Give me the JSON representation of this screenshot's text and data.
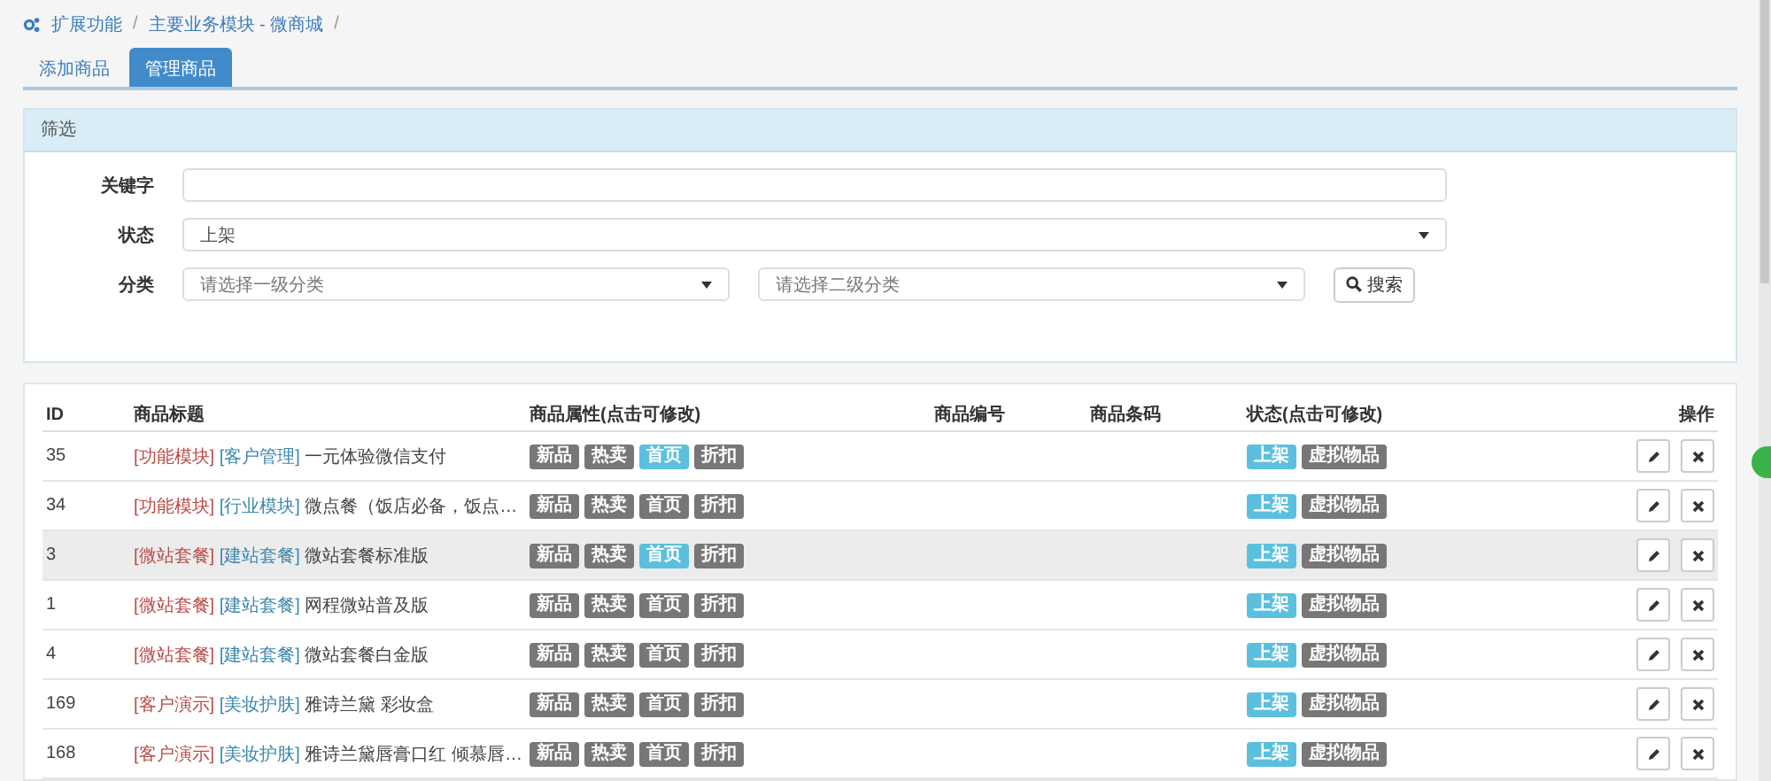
{
  "breadcrumb": [
    {
      "label": "扩展功能",
      "separator": "/"
    },
    {
      "label": "主要业务模块 - 微商城",
      "separator": "/"
    }
  ],
  "tabs": [
    {
      "label": "添加商品",
      "selected": false
    },
    {
      "label": "管理商品",
      "selected": true
    }
  ],
  "filter": {
    "title": "筛选",
    "keyword": {
      "label": "关键字"
    },
    "status": {
      "label": "状态",
      "value": "上架"
    },
    "category": {
      "label": "分类",
      "first_placeholder": "请选择一级分类",
      "second_placeholder": "请选择二级分类"
    },
    "search_button": "搜索"
  },
  "table": {
    "columns": [
      "ID",
      "商品标题",
      "商品属性(点击可修改)",
      "商品编号",
      "商品条码",
      "状态(点击可修改)",
      "操作"
    ],
    "rows": [
      {
        "id": "35",
        "group": "[功能模块]",
        "category": "[客户管理]",
        "title": "一元体验微信支付",
        "highlighted": false,
        "attributes": [
          {
            "label": "新品",
            "on": false
          },
          {
            "label": "热卖",
            "on": false
          },
          {
            "label": "首页",
            "on": true
          },
          {
            "label": "折扣",
            "on": false
          }
        ],
        "status": [
          {
            "label": "上架",
            "on": true
          },
          {
            "label": "虚拟物品",
            "on": false
          }
        ]
      },
      {
        "id": "34",
        "group": "[功能模块]",
        "category": "[行业模块]",
        "title": "微点餐（饭店必备，饭点…",
        "highlighted": false,
        "attributes": [
          {
            "label": "新品",
            "on": false
          },
          {
            "label": "热卖",
            "on": false
          },
          {
            "label": "首页",
            "on": false
          },
          {
            "label": "折扣",
            "on": false
          }
        ],
        "status": [
          {
            "label": "上架",
            "on": true
          },
          {
            "label": "虚拟物品",
            "on": false
          }
        ]
      },
      {
        "id": "3",
        "group": "[微站套餐]",
        "category": "[建站套餐]",
        "title": "微站套餐标准版",
        "highlighted": true,
        "attributes": [
          {
            "label": "新品",
            "on": false
          },
          {
            "label": "热卖",
            "on": false
          },
          {
            "label": "首页",
            "on": true
          },
          {
            "label": "折扣",
            "on": false
          }
        ],
        "status": [
          {
            "label": "上架",
            "on": true
          },
          {
            "label": "虚拟物品",
            "on": false
          }
        ]
      },
      {
        "id": "1",
        "group": "[微站套餐]",
        "category": "[建站套餐]",
        "title": "网程微站普及版",
        "highlighted": false,
        "attributes": [
          {
            "label": "新品",
            "on": false
          },
          {
            "label": "热卖",
            "on": false
          },
          {
            "label": "首页",
            "on": false
          },
          {
            "label": "折扣",
            "on": false
          }
        ],
        "status": [
          {
            "label": "上架",
            "on": true
          },
          {
            "label": "虚拟物品",
            "on": false
          }
        ]
      },
      {
        "id": "4",
        "group": "[微站套餐]",
        "category": "[建站套餐]",
        "title": "微站套餐白金版",
        "highlighted": false,
        "attributes": [
          {
            "label": "新品",
            "on": false
          },
          {
            "label": "热卖",
            "on": false
          },
          {
            "label": "首页",
            "on": false
          },
          {
            "label": "折扣",
            "on": false
          }
        ],
        "status": [
          {
            "label": "上架",
            "on": true
          },
          {
            "label": "虚拟物品",
            "on": false
          }
        ]
      },
      {
        "id": "169",
        "group": "[客户演示]",
        "category": "[美妆护肤]",
        "title": "雅诗兰黛 彩妆盒",
        "highlighted": false,
        "attributes": [
          {
            "label": "新品",
            "on": false
          },
          {
            "label": "热卖",
            "on": false
          },
          {
            "label": "首页",
            "on": false
          },
          {
            "label": "折扣",
            "on": false
          }
        ],
        "status": [
          {
            "label": "上架",
            "on": true
          },
          {
            "label": "虚拟物品",
            "on": false
          }
        ]
      },
      {
        "id": "168",
        "group": "[客户演示]",
        "category": "[美妆护肤]",
        "title": "雅诗兰黛唇膏口红 倾慕唇…",
        "highlighted": false,
        "attributes": [
          {
            "label": "新品",
            "on": false
          },
          {
            "label": "热卖",
            "on": false
          },
          {
            "label": "首页",
            "on": false
          },
          {
            "label": "折扣",
            "on": false
          }
        ],
        "status": [
          {
            "label": "上架",
            "on": true
          },
          {
            "label": "虚拟物品",
            "on": false
          }
        ]
      }
    ]
  }
}
